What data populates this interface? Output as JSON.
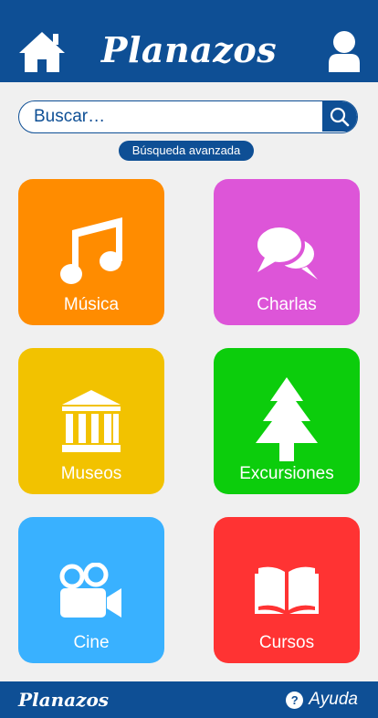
{
  "header": {
    "title": "Planazos",
    "home_icon": "home-icon",
    "user_icon": "user-icon"
  },
  "search": {
    "placeholder": "Buscar…",
    "value": "",
    "advanced_label": "Búsqueda avanzada"
  },
  "categories": [
    {
      "label": "Música",
      "icon": "music-note-icon",
      "color": "#ff8c00"
    },
    {
      "label": "Charlas",
      "icon": "chat-bubbles-icon",
      "color": "#dd55d8"
    },
    {
      "label": "Museos",
      "icon": "museum-icon",
      "color": "#f2c200"
    },
    {
      "label": "Excursiones",
      "icon": "tree-icon",
      "color": "#0ccd0c"
    },
    {
      "label": "Cine",
      "icon": "video-camera-icon",
      "color": "#39b1ff"
    },
    {
      "label": "Cursos",
      "icon": "open-book-icon",
      "color": "#ff3333"
    }
  ],
  "footer": {
    "brand": "Planazos",
    "help_label": "Ayuda",
    "help_icon_char": "?"
  },
  "colors": {
    "brand_blue": "#0e4f95",
    "background": "#f0f0f0"
  }
}
